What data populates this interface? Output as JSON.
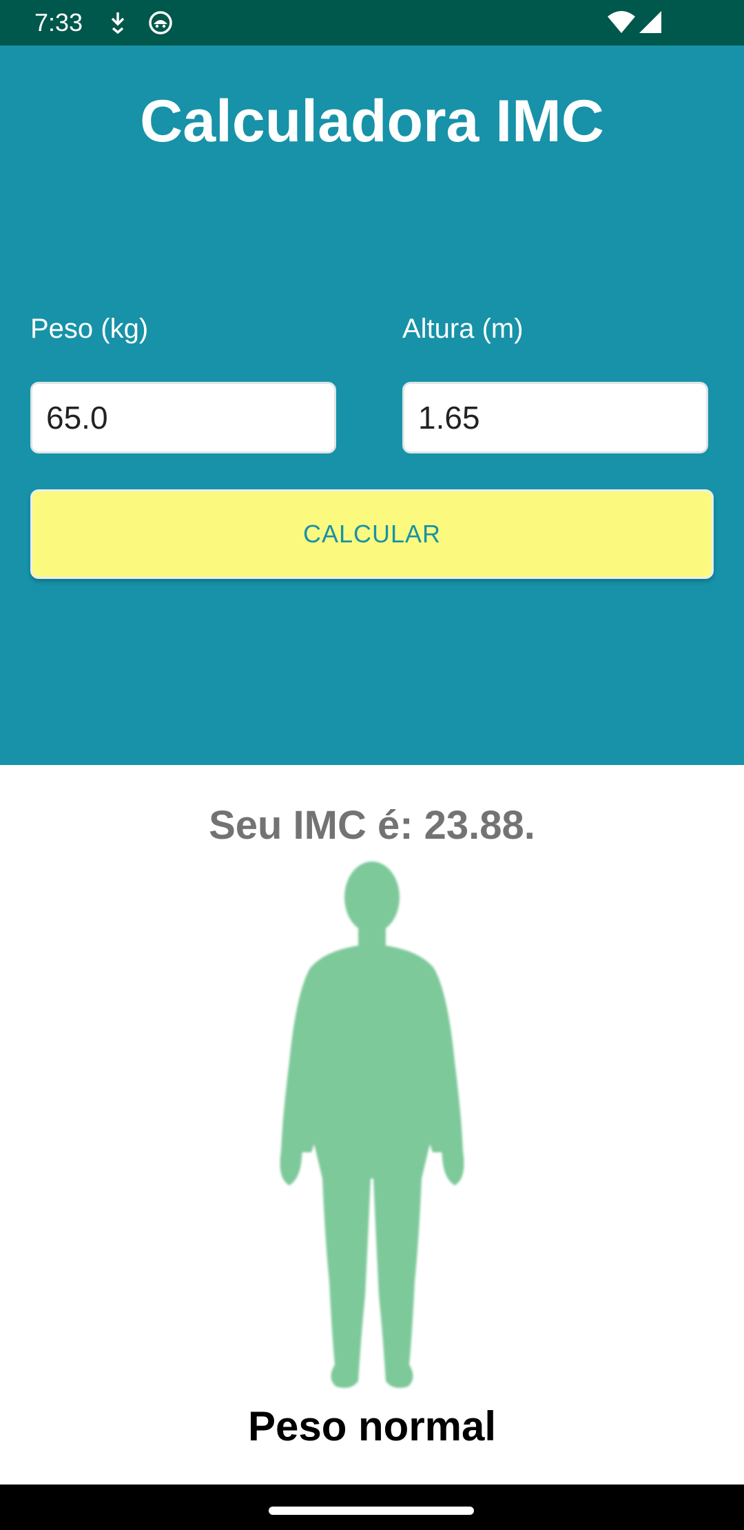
{
  "status_bar": {
    "time": "7:33",
    "icons_left": [
      "download-arrow-icon",
      "android-robot-icon"
    ],
    "icons_right": [
      "wifi-icon",
      "cellular-signal-icon"
    ]
  },
  "app": {
    "title": "Calculadora IMC",
    "header_color": "#1792a8"
  },
  "form": {
    "weight_label": "Peso (kg)",
    "weight_value": "65.0",
    "height_label": "Altura (m)",
    "height_value": "1.65",
    "calculate_label": "CALCULAR",
    "button_color": "#fcfa7e"
  },
  "result": {
    "bmi_text": "Seu IMC é: 23.88.",
    "category": "Peso normal",
    "figure_icon": "human-silhouette-icon",
    "figure_color": "#7dc99a"
  }
}
